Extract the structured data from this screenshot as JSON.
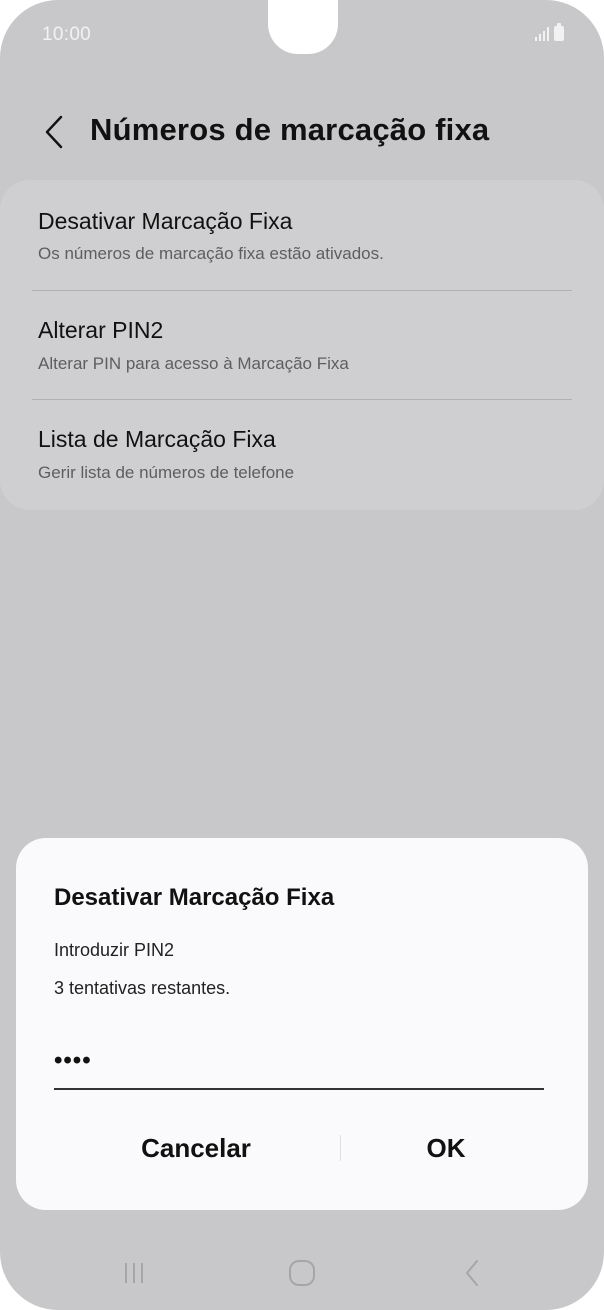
{
  "status_bar": {
    "time": "10:00"
  },
  "header": {
    "title": "Números de marcação fixa"
  },
  "settings": {
    "items": [
      {
        "title": "Desativar Marcação Fixa",
        "subtitle": "Os números de marcação fixa estão ativados."
      },
      {
        "title": "Alterar PIN2",
        "subtitle": "Alterar PIN para acesso à Marcação Fixa"
      },
      {
        "title": "Lista de Marcação Fixa",
        "subtitle": "Gerir lista de números de telefone"
      }
    ]
  },
  "dialog": {
    "title": "Desativar Marcação Fixa",
    "message_line1": "Introduzir PIN2",
    "message_line2": "3 tentativas restantes.",
    "pin_value": "••••",
    "cancel_label": "Cancelar",
    "ok_label": "OK"
  },
  "nav": {
    "recents_icon": "recent-apps-icon",
    "home_icon": "home-icon",
    "back_icon": "back-icon"
  },
  "colors": {
    "scrim_background": "#c8c8ca",
    "card_background": "#cfcfd1",
    "dialog_background": "#fafafc"
  }
}
